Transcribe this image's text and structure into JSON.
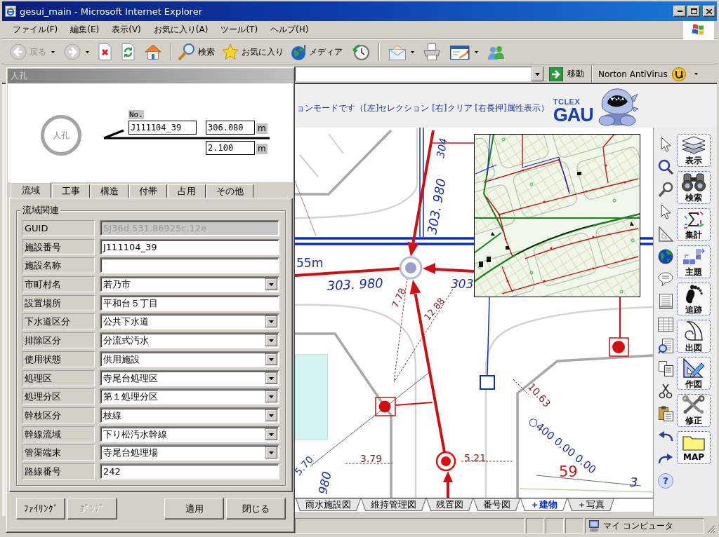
{
  "window": {
    "title": "gesui_main - Microsoft Internet Explorer"
  },
  "menu": [
    "ファイル(F)",
    "編集(E)",
    "表示(V)",
    "お気に入り(A)",
    "ツール(T)",
    "ヘルプ(H)"
  ],
  "toolbar": {
    "back": {
      "label": "戻る",
      "disabled": true
    },
    "forward": {
      "disabled": true
    },
    "search": {
      "label": "検索"
    },
    "favorites": {
      "label": "お気に入り"
    },
    "media": {
      "label": "メディア"
    }
  },
  "address_bar": {
    "go": {
      "label": "移動"
    },
    "norton": {
      "label": "Norton AntiVirus"
    }
  },
  "dialog": {
    "title": "人孔",
    "symbol": "人孔",
    "number_label": "No.",
    "facility_number": "J111104_39",
    "elevation": "306.080",
    "elevation_unit": "m",
    "depth": "2.100",
    "depth_unit": "m",
    "tabs": [
      {
        "label": "流域",
        "selected": true
      },
      {
        "label": "工事",
        "selected": false
      },
      {
        "label": "構造",
        "selected": false
      },
      {
        "label": "付帯",
        "selected": false
      },
      {
        "label": "占用",
        "selected": false
      },
      {
        "label": "その他",
        "selected": false
      }
    ],
    "group_title": "流域関連",
    "fields": [
      {
        "label": "GUID",
        "kind": "text",
        "value": "SJ36d.531.86925c.12e",
        "disabled": true
      },
      {
        "label": "施設番号",
        "kind": "text",
        "value": "J111104_39",
        "disabled": false
      },
      {
        "label": "施設名称",
        "kind": "text",
        "disabled": false
      },
      {
        "label": "市町村名",
        "kind": "select",
        "value": "若乃市",
        "disabled": false
      },
      {
        "label": "設置場所",
        "kind": "text",
        "value": "平和台５丁目",
        "disabled": false
      },
      {
        "label": "下水道区分",
        "kind": "select",
        "value": "公共下水道",
        "disabled": false
      },
      {
        "label": "排除区分",
        "kind": "select",
        "value": "分流式汚水",
        "disabled": false
      },
      {
        "label": "使用状態",
        "kind": "select",
        "value": "供用施設",
        "disabled": false
      },
      {
        "label": "処理区",
        "kind": "select",
        "value": "寺尾台処理区",
        "disabled": false
      },
      {
        "label": "処理分区",
        "kind": "select",
        "value": "第１処理分区",
        "disabled": false
      },
      {
        "label": "幹枝区分",
        "kind": "select",
        "value": "枝線",
        "disabled": false
      },
      {
        "label": "幹線流域",
        "kind": "select",
        "value": "下り松汚水幹線",
        "disabled": false
      },
      {
        "label": "管渠端末",
        "kind": "select",
        "value": "寺尾台処理場",
        "disabled": false
      },
      {
        "label": "路線番号",
        "kind": "text",
        "value": "242",
        "disabled": false
      }
    ],
    "buttons": [
      {
        "label": "ﾌｧｲﾘﾝｸﾞ",
        "disabled": false
      },
      {
        "label": "ﾎﾟﾝﾌﾟ",
        "disabled": true
      },
      {
        "label": "適用",
        "disabled": false
      },
      {
        "label": "閉じる",
        "disabled": false
      }
    ]
  },
  "page": {
    "mode_hint": "ョンモードです（[左]セレクション [右]クリア [右長押]属性表示）",
    "logo": {
      "line_1": "TCLEX",
      "line_2": "GAU"
    }
  },
  "map": {
    "labels": [
      "304",
      "303. 980",
      "55m",
      "303. 980",
      "7.78",
      "12.88",
      "303",
      "10.63",
      "○400 0.00 0.00",
      "59",
      "3",
      "3.79",
      "5.21",
      "5.70",
      "980"
    ],
    "tabs": [
      {
        "label": "雨水施設図",
        "selected": false
      },
      {
        "label": "維持管理図",
        "selected": false
      },
      {
        "label": "残置図",
        "selected": false
      },
      {
        "label": "番号図",
        "selected": false
      },
      {
        "label": "＋建物",
        "selected": true
      },
      {
        "label": "＋写真",
        "selected": false
      }
    ]
  },
  "tools": {
    "buttons": [
      "表示",
      "検索",
      "集計",
      "主題",
      "追跡",
      "出図",
      "作図",
      "修正",
      "MAP"
    ],
    "help": "?"
  },
  "status_bar": {
    "zone": "マイ コンピュータ"
  }
}
